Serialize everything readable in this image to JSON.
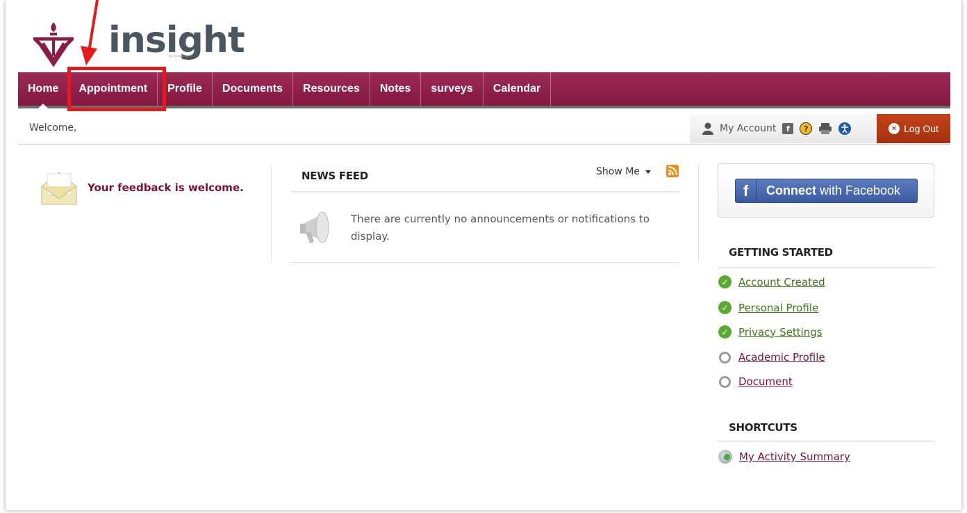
{
  "brand": {
    "name": "insight",
    "sub": "by Symplicity"
  },
  "nav": {
    "items": [
      {
        "label": "Home",
        "active": true
      },
      {
        "label": "Appointment",
        "active": false
      },
      {
        "label": "Profile",
        "active": false
      },
      {
        "label": "Documents",
        "active": false
      },
      {
        "label": "Resources",
        "active": false
      },
      {
        "label": "Notes",
        "active": false
      },
      {
        "label": "surveys",
        "active": false
      },
      {
        "label": "Calendar",
        "active": false
      }
    ]
  },
  "welcome": {
    "text": "Welcome,"
  },
  "account": {
    "my_account": "My Account",
    "logout": "Log Out"
  },
  "feedback": {
    "text": "Your feedback is welcome."
  },
  "news": {
    "title": "NEWS FEED",
    "show_me": "Show Me",
    "message": "There are currently no announcements or notifications to display."
  },
  "facebook": {
    "connect": "Connect",
    "with": "with Facebook"
  },
  "getting_started": {
    "title": "GETTING STARTED",
    "items": [
      {
        "label": "Account Created",
        "done": true
      },
      {
        "label": "Personal Profile",
        "done": true
      },
      {
        "label": "Privacy Settings",
        "done": true
      },
      {
        "label": "Academic Profile",
        "done": false
      },
      {
        "label": "Document",
        "done": false
      }
    ]
  },
  "shortcuts": {
    "title": "SHORTCUTS",
    "items": [
      {
        "label": "My Activity Summary"
      }
    ]
  },
  "colors": {
    "brand": "#8a1d47",
    "logout": "#b23a14",
    "facebook": "#3b5b9d",
    "done": "#5aa932",
    "annotation": "#e51a1a"
  }
}
